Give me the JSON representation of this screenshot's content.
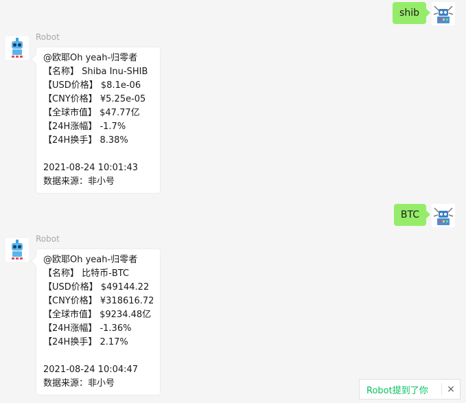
{
  "messages": [
    {
      "side": "right",
      "text": "shib"
    },
    {
      "side": "left",
      "sender": "Robot",
      "lines": [
        "@欧耶Oh yeah-归零者",
        "【名称】 Shiba Inu-SHIB",
        "【USD价格】 $8.1e-06",
        "【CNY价格】 ¥5.25e-05",
        "【全球市值】 $47.77亿",
        "【24H涨幅】 -1.7%",
        "【24H换手】 8.38%",
        "",
        "2021-08-24 10:01:43",
        "数据来源：非小号"
      ]
    },
    {
      "side": "right",
      "text": "BTC"
    },
    {
      "side": "left",
      "sender": "Robot",
      "lines": [
        "@欧耶Oh yeah-归零者",
        "【名称】 比特币-BTC",
        "【USD价格】 $49144.22",
        "【CNY价格】 ¥318616.72",
        "【全球市值】 $9234.48亿",
        "【24H涨幅】 -1.36%",
        "【24H换手】 2.17%",
        "",
        "2021-08-24 10:04:47",
        "数据来源：非小号"
      ]
    }
  ],
  "toast": {
    "text": "Robot提到了你",
    "close": "×"
  },
  "colors": {
    "self_bubble": "#95ec69",
    "toast_text": "#07c160",
    "background": "#f5f5f5"
  },
  "icons": {
    "robot_avatar": "robot-avatar-icon",
    "user_avatar": "robot-user-avatar-icon",
    "close": "close-icon"
  }
}
